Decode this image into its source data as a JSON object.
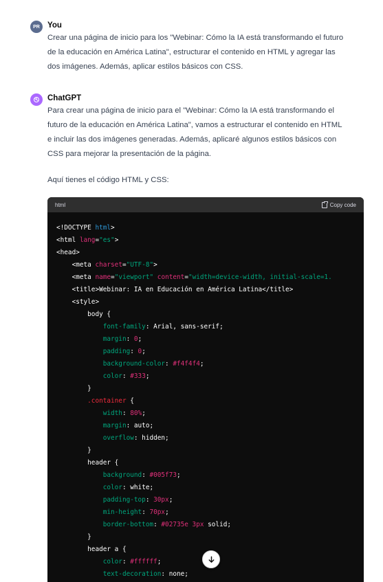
{
  "messages": [
    {
      "avatar": "PR",
      "author": "You",
      "lines": [
        "Crear una página de inicio para los \"Webinar: Cómo la IA está transformando el futuro",
        "de la educación en América Latina\", estructurar el contenido en HTML y agregar las",
        "dos imágenes. Además, aplicar estilos básicos con CSS."
      ]
    },
    {
      "avatar_icon": "openai-logo-icon",
      "author": "ChatGPT",
      "lines": [
        "Para crear una página de inicio para el \"Webinar: Cómo la IA está transformando el",
        "futuro de la educación en América Latina\", vamos a estructurar el contenido en HTML",
        "e incluir las dos imágenes generadas. Además, aplicaré algunos estilos básicos con",
        "CSS para mejorar la presentación de la página."
      ],
      "intro": "Aquí tienes el código HTML y CSS:"
    }
  ],
  "code": {
    "language": "html",
    "copy_label": "Copy code",
    "colors": {
      "tag": "#2e95d3",
      "attr": "#df3079",
      "string": "#00a67d",
      "prop": "#df3079",
      "value": "#df3079",
      "plain": "#ffffff",
      "key": "#f22c3d"
    },
    "lines": [
      [
        [
          "plain",
          "<!DOCTYPE "
        ],
        [
          "tag",
          "html"
        ],
        [
          "plain",
          ">"
        ]
      ],
      [
        [
          "plain",
          "<html "
        ],
        [
          "attr",
          "lang"
        ],
        [
          "plain",
          "="
        ],
        [
          "string",
          "\"es\""
        ],
        [
          "plain",
          ">"
        ]
      ],
      [
        [
          "plain",
          "<head>"
        ]
      ],
      [
        [
          "plain",
          "    <meta "
        ],
        [
          "attr",
          "charset"
        ],
        [
          "plain",
          "="
        ],
        [
          "string",
          "\"UTF-8\""
        ],
        [
          "plain",
          ">"
        ]
      ],
      [
        [
          "plain",
          "    <meta "
        ],
        [
          "attr",
          "name"
        ],
        [
          "plain",
          "="
        ],
        [
          "string",
          "\"viewport\""
        ],
        [
          "plain",
          " "
        ],
        [
          "attr",
          "content"
        ],
        [
          "plain",
          "="
        ],
        [
          "string",
          "\"width=device-width, initial-scale=1."
        ]
      ],
      [
        [
          "plain",
          "    <title>Webinar: IA en Educación en América Latina</title>"
        ]
      ],
      [
        [
          "plain",
          "    <style>"
        ]
      ],
      [
        [
          "plain",
          "        body {"
        ]
      ],
      [
        [
          "plain",
          "            "
        ],
        [
          "string",
          "font-family"
        ],
        [
          "plain",
          ": Arial, sans-serif;"
        ]
      ],
      [
        [
          "plain",
          "            "
        ],
        [
          "string",
          "margin"
        ],
        [
          "plain",
          ": "
        ],
        [
          "value",
          "0"
        ],
        [
          "plain",
          ";"
        ]
      ],
      [
        [
          "plain",
          "            "
        ],
        [
          "string",
          "padding"
        ],
        [
          "plain",
          ": "
        ],
        [
          "value",
          "0"
        ],
        [
          "plain",
          ";"
        ]
      ],
      [
        [
          "plain",
          "            "
        ],
        [
          "string",
          "background-color"
        ],
        [
          "plain",
          ": "
        ],
        [
          "value",
          "#f4f4f4"
        ],
        [
          "plain",
          ";"
        ]
      ],
      [
        [
          "plain",
          "            "
        ],
        [
          "string",
          "color"
        ],
        [
          "plain",
          ": "
        ],
        [
          "value",
          "#333"
        ],
        [
          "plain",
          ";"
        ]
      ],
      [
        [
          "plain",
          "        }"
        ]
      ],
      [
        [
          "plain",
          "        "
        ],
        [
          "key",
          ".container"
        ],
        [
          "plain",
          " {"
        ]
      ],
      [
        [
          "plain",
          "            "
        ],
        [
          "string",
          "width"
        ],
        [
          "plain",
          ": "
        ],
        [
          "value",
          "80%"
        ],
        [
          "plain",
          ";"
        ]
      ],
      [
        [
          "plain",
          "            "
        ],
        [
          "string",
          "margin"
        ],
        [
          "plain",
          ": auto;"
        ]
      ],
      [
        [
          "plain",
          "            "
        ],
        [
          "string",
          "overflow"
        ],
        [
          "plain",
          ": hidden;"
        ]
      ],
      [
        [
          "plain",
          "        }"
        ]
      ],
      [
        [
          "plain",
          "        header {"
        ]
      ],
      [
        [
          "plain",
          "            "
        ],
        [
          "string",
          "background"
        ],
        [
          "plain",
          ": "
        ],
        [
          "value",
          "#005f73"
        ],
        [
          "plain",
          ";"
        ]
      ],
      [
        [
          "plain",
          "            "
        ],
        [
          "string",
          "color"
        ],
        [
          "plain",
          ": white;"
        ]
      ],
      [
        [
          "plain",
          "            "
        ],
        [
          "string",
          "padding-top"
        ],
        [
          "plain",
          ": "
        ],
        [
          "value",
          "30px"
        ],
        [
          "plain",
          ";"
        ]
      ],
      [
        [
          "plain",
          "            "
        ],
        [
          "string",
          "min-height"
        ],
        [
          "plain",
          ": "
        ],
        [
          "value",
          "70px"
        ],
        [
          "plain",
          ";"
        ]
      ],
      [
        [
          "plain",
          "            "
        ],
        [
          "string",
          "border-bottom"
        ],
        [
          "plain",
          ": "
        ],
        [
          "value",
          "#02735e 3px"
        ],
        [
          "plain",
          " solid;"
        ]
      ],
      [
        [
          "plain",
          "        }"
        ]
      ],
      [
        [
          "plain",
          "        header a {"
        ]
      ],
      [
        [
          "plain",
          "            "
        ],
        [
          "string",
          "color"
        ],
        [
          "plain",
          ": "
        ],
        [
          "value",
          "#ffffff"
        ],
        [
          "plain",
          ";"
        ]
      ],
      [
        [
          "plain",
          "            "
        ],
        [
          "string",
          "text-decoration"
        ],
        [
          "plain",
          ": none;"
        ]
      ]
    ]
  },
  "scroll_button_icon": "arrow-down-icon"
}
